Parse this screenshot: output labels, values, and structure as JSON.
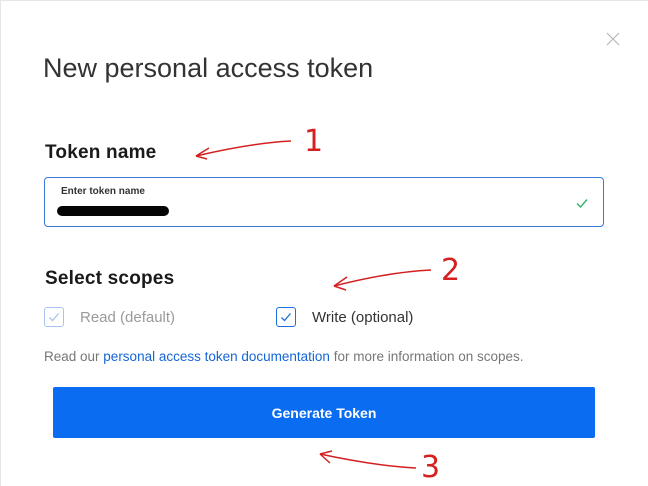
{
  "modal": {
    "title": "New personal access token",
    "close_icon": "close-icon"
  },
  "token": {
    "section_label": "Token name",
    "field_label": "Enter token name",
    "field_value": "",
    "valid_icon": "checkmark-icon"
  },
  "scopes": {
    "section_label": "Select scopes",
    "read_label": "Read (default)",
    "read_checked": true,
    "read_disabled": true,
    "write_label": "Write (optional)",
    "write_checked": true
  },
  "help": {
    "prefix": "Read our ",
    "link": "personal access token documentation",
    "suffix": " for more information on scopes."
  },
  "actions": {
    "generate_label": "Generate Token"
  },
  "annotations": {
    "one": "1",
    "two": "2",
    "three": "3",
    "color": "#d42020"
  },
  "colors": {
    "accent": "#0a6cf0",
    "link": "#1565d8",
    "field_border": "#3b79d6",
    "valid": "#2fb36a"
  }
}
